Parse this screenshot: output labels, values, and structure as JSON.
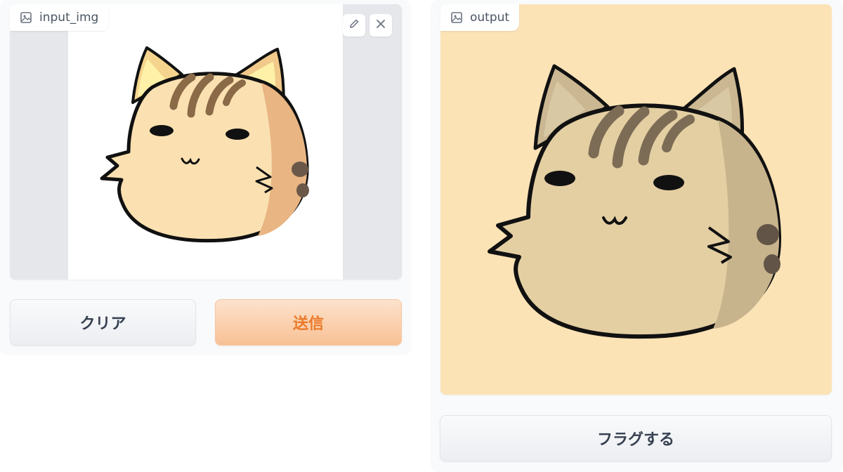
{
  "input": {
    "label": "input_img",
    "label_icon": "image-icon",
    "edit_icon": "pencil-icon",
    "close_icon": "close-icon"
  },
  "output": {
    "label": "output",
    "label_icon": "image-icon"
  },
  "buttons": {
    "clear": "クリア",
    "submit": "送信",
    "flag": "フラグする"
  },
  "colors": {
    "accent": "#ea7a2a",
    "output_background": "#fce3b6"
  }
}
